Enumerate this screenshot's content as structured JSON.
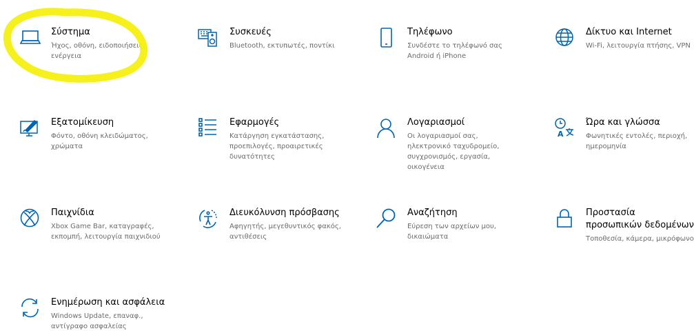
{
  "accent_color": "#0063b1",
  "highlight_color": "#f5f00a",
  "tiles": [
    {
      "icon": "laptop-icon",
      "title": "Σύστημα",
      "desc": "Ήχος, οθόνη, ειδοποιήσεις, ενέργεια"
    },
    {
      "icon": "keyboard-speaker-icon",
      "title": "Συσκευές",
      "desc": "Bluetooth, εκτυπωτές, ποντίκι"
    },
    {
      "icon": "phone-icon",
      "title": "Τηλέφωνο",
      "desc": "Συνδέστε το τηλέφωνό σας Android ή iPhone"
    },
    {
      "icon": "globe-icon",
      "title": "Δίκτυο και Internet",
      "desc": "Wi-Fi, λειτουργία πτήσης, VPN"
    },
    {
      "icon": "personalization-icon",
      "title": "Εξατομίκευση",
      "desc": "Φόντο, οθόνη κλειδώματος, χρώματα"
    },
    {
      "icon": "apps-list-icon",
      "title": "Εφαρμογές",
      "desc": "Κατάργηση εγκατάστασης, προεπιλογές, προαιρετικές δυνατότητες"
    },
    {
      "icon": "person-icon",
      "title": "Λογαριασμοί",
      "desc": "Οι λογαριασμοί σας, ηλεκτρονικό ταχυδρομείο, συγχρονισμός, εργασία, οικογένεια"
    },
    {
      "icon": "time-language-icon",
      "title": "Ώρα και γλώσσα",
      "desc": "Φωνητικές εντολές, περιοχή, ημερομηνία"
    },
    {
      "icon": "xbox-icon",
      "title": "Παιχνίδια",
      "desc": "Xbox Game Bar, καταγραφές, εκπομπή, λειτουργία παιχνιδιού"
    },
    {
      "icon": "ease-of-access-icon",
      "title": "Διευκόλυνση πρόσβασης",
      "desc": "Αφηγητής, μεγεθυντικός φακός, αντιθέσεις"
    },
    {
      "icon": "search-icon",
      "title": "Αναζήτηση",
      "desc": "Εύρεση των αρχείων μου, δικαιώματα"
    },
    {
      "icon": "lock-icon",
      "title": "Προστασία προσωπικών δεδομένων",
      "desc": "Τοποθεσία, κάμερα, μικρόφωνο"
    },
    {
      "icon": "sync-arrows-icon",
      "title": "Ενημέρωση και ασφάλεια",
      "desc": "Windows Update, επαναφ., αντίγραφο ασφαλείας"
    }
  ]
}
